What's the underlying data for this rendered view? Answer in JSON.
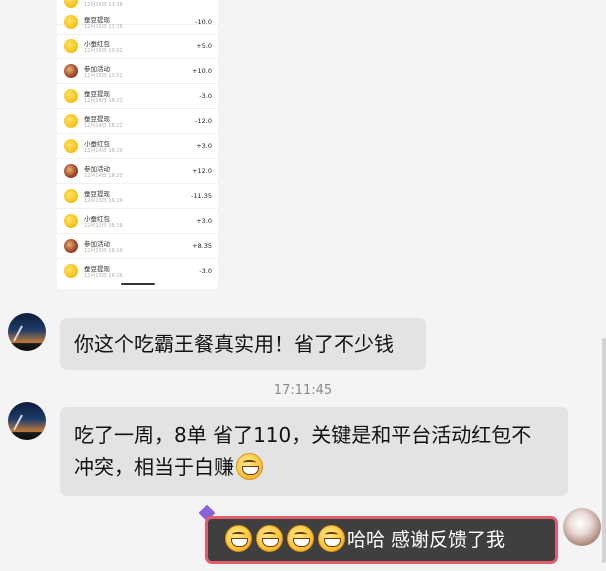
{
  "ledger": {
    "rows": [
      {
        "title": "",
        "date": "12月15日 13:38",
        "amount": "",
        "icon": "coin"
      },
      {
        "title": "蚕豆提现",
        "date": "12月15日 13:38",
        "amount": "-10.0",
        "icon": "coin"
      },
      {
        "title": "小蚕红包",
        "date": "12月15日 13:01",
        "amount": "+5.0",
        "icon": "coin"
      },
      {
        "title": "参加活动",
        "date": "12月15日 13:01",
        "amount": "+10.0",
        "icon": "event"
      },
      {
        "title": "蚕豆提现",
        "date": "12月14日 18:21",
        "amount": "-3.0",
        "icon": "coin"
      },
      {
        "title": "蚕豆提现",
        "date": "12月14日 18:21",
        "amount": "-12.0",
        "icon": "coin"
      },
      {
        "title": "小蚕红包",
        "date": "12月14日 18:20",
        "amount": "+3.0",
        "icon": "coin"
      },
      {
        "title": "参加活动",
        "date": "12月14日 18:20",
        "amount": "+12.0",
        "icon": "event"
      },
      {
        "title": "蚕豆提现",
        "date": "12月13日 16:19",
        "amount": "-11.35",
        "icon": "coin"
      },
      {
        "title": "小蚕红包",
        "date": "12月13日 16:19",
        "amount": "+3.0",
        "icon": "coin"
      },
      {
        "title": "参加活动",
        "date": "12月13日 16:19",
        "amount": "+8.35",
        "icon": "event"
      },
      {
        "title": "蚕豆提现",
        "date": "12月13日 16:16",
        "amount": "-3.0",
        "icon": "coin"
      }
    ]
  },
  "chat": {
    "msg1": "你这个吃霸王餐真实用！省了不少钱",
    "timestamp": "17:11:45",
    "msg2_line1": "吃了一周，8单  省了110，关键是和平台活动红包不",
    "msg2_line2": "冲突，相当于白赚",
    "reply_text": "哈哈 感谢反馈了我"
  },
  "icons": {
    "emoji": "grinning-face-icon",
    "gem": "gem-badge-icon"
  },
  "colors": {
    "bubble_gray": "#e3e3e3",
    "reply_bg": "#3f3f3f",
    "reply_border": "#e25d6a"
  }
}
